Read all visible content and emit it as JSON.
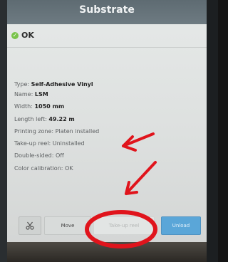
{
  "dialog": {
    "title": "Substrate",
    "status": "OK",
    "rows": [
      {
        "label": "Type: ",
        "value": "Self-Adhesive Vinyl"
      },
      {
        "label": "Name: ",
        "value": "LSM"
      },
      {
        "label": "Width: ",
        "value": "1050 mm"
      },
      {
        "label": "Length left: ",
        "value": "49.22 m"
      },
      {
        "label": "Printing zone: ",
        "value": "Platen installed"
      },
      {
        "label": "Take-up reel: ",
        "value": "Uninstalled"
      },
      {
        "label": "Double-sided: ",
        "value": "Off"
      },
      {
        "label": "Color calibration: ",
        "value": "OK"
      }
    ]
  },
  "buttons": {
    "move": "Move",
    "takeup": "Take-up reel",
    "unload": "Unload"
  },
  "icons": {
    "status": "check-circle-icon",
    "tools": "scissors-icon"
  },
  "colors": {
    "ok_green": "#79c34b",
    "unload_blue": "#5aa6d8",
    "annotation_red": "#e0141c"
  }
}
